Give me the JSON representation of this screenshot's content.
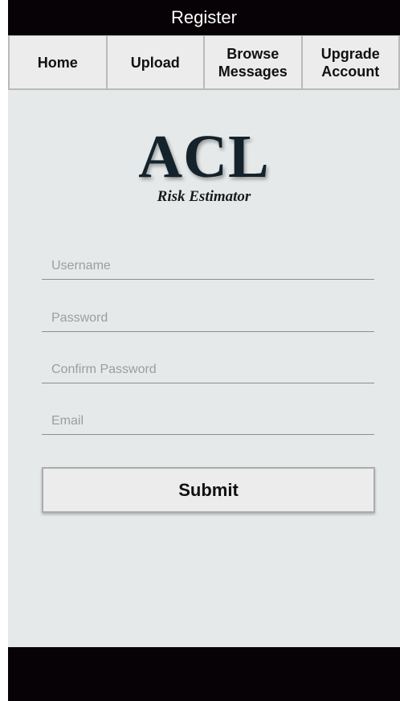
{
  "header": {
    "title": "Register"
  },
  "nav": {
    "items": [
      {
        "label": "Home"
      },
      {
        "label": "Upload"
      },
      {
        "label": "Browse\nMessages"
      },
      {
        "label": "Upgrade\nAccount"
      }
    ]
  },
  "logo": {
    "main": "ACL",
    "subtitle": "Risk Estimator"
  },
  "form": {
    "username_placeholder": "Username",
    "password_placeholder": "Password",
    "confirm_placeholder": "Confirm Password",
    "email_placeholder": "Email",
    "submit_label": "Submit"
  },
  "colors": {
    "bar_background": "#070205",
    "screen_background": "#e6e9ea",
    "button_background": "#ececec"
  }
}
